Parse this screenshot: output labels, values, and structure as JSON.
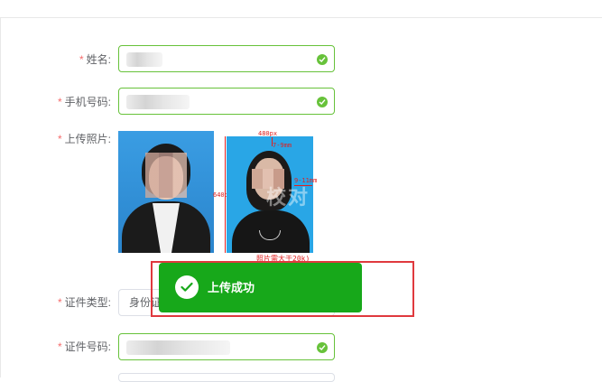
{
  "form": {
    "name": {
      "label": "姓名:",
      "required": "*"
    },
    "phone": {
      "label": "手机号码:",
      "required": "*"
    },
    "photo": {
      "label": "上传照片:",
      "required": "*"
    },
    "idtype": {
      "label": "证件类型:",
      "required": "*",
      "value": "身份证"
    },
    "idnumber": {
      "label": "证件号码:",
      "required": "*"
    }
  },
  "sample": {
    "width_label": "480px",
    "height_label": "640px",
    "top_margin": "7-9mm",
    "side_margin": "9-11mm",
    "caption": "照片需大于20k)",
    "watermark": "校对"
  },
  "toast": {
    "message": "上传成功"
  },
  "colors": {
    "success": "#67c23a",
    "toast": "#17a81a",
    "required": "#f56c6c",
    "highlight": "#e0393e"
  }
}
